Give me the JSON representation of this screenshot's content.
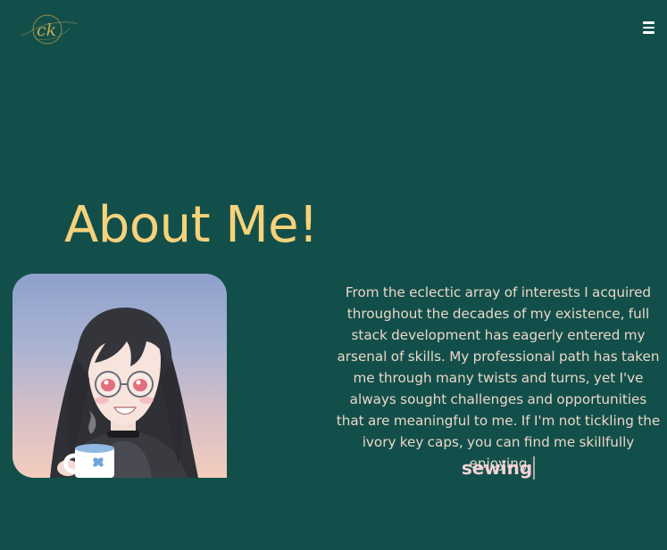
{
  "colors": {
    "background": "#134f4a",
    "heading": "#f6d27a",
    "body_text": "#e9d7c8",
    "typed_word": "#f4d2d6",
    "logo_gold": "#b59a4b",
    "cursor": "#a9a9a9"
  },
  "nav": {
    "logo_text": "ck",
    "menu_icon": "hamburger-menu-icon"
  },
  "about": {
    "heading": "About Me!",
    "bio": "From the eclectic array of interests I acquired throughout the decades of my existence, full stack development has eagerly entered my arsenal of skills. My professional path has taken me through many twists and turns, yet I've always sought challenges and opportunities that are meaningful to me. If I'm not tickling the ivory key caps, you can find me skillfully enjoying",
    "typed_word": "sewing",
    "avatar_icon": "anime-avatar-illustration"
  }
}
